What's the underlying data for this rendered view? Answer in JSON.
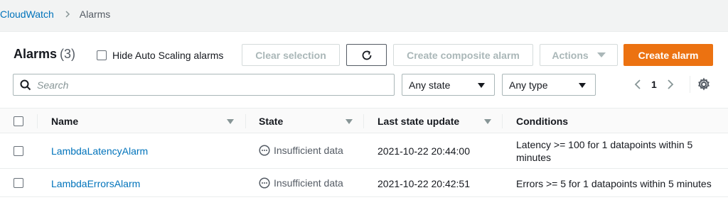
{
  "breadcrumb": {
    "root": "CloudWatch",
    "current": "Alarms"
  },
  "header": {
    "title": "Alarms",
    "count": "(3)",
    "hide_autoscaling_label": "Hide Auto Scaling alarms"
  },
  "toolbar": {
    "clear_selection": "Clear selection",
    "create_composite": "Create composite alarm",
    "actions": "Actions",
    "create_alarm": "Create alarm"
  },
  "filters": {
    "search_placeholder": "Search",
    "state_value": "Any state",
    "type_value": "Any type"
  },
  "pagination": {
    "page": "1"
  },
  "table": {
    "columns": [
      "Name",
      "State",
      "Last state update",
      "Conditions"
    ],
    "rows": [
      {
        "name": "LambdaLatencyAlarm",
        "state": "Insufficient data",
        "last_update": "2021-10-22 20:44:00",
        "condition_line1": "Latency >= 100 for 1 datapoints within 5",
        "condition_line2": "minutes"
      },
      {
        "name": "LambdaErrorsAlarm",
        "state": "Insufficient data",
        "last_update": "2021-10-22 20:42:51",
        "condition_line1": "Errors >= 5 for 1 datapoints within 5 minutes",
        "condition_line2": ""
      }
    ]
  },
  "colors": {
    "link": "#0073bb",
    "primary_button": "#ec7211",
    "disabled_text": "#aab7b8"
  }
}
